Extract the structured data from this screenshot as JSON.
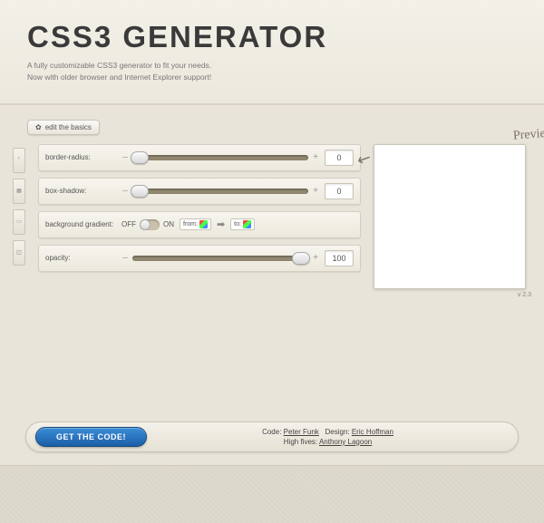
{
  "header": {
    "title": "CSS3 GENERATOR",
    "subtitle_line1": "A fully customizable CSS3 generator to fit your needs.",
    "subtitle_line2": "Now with older browser and Internet Explorer support!"
  },
  "edit_basics_label": "edit the basics",
  "controls": {
    "border_radius": {
      "label": "border-radius:",
      "value": "0"
    },
    "box_shadow": {
      "label": "box-shadow:",
      "value": "0"
    },
    "gradient": {
      "label": "background gradient:",
      "off": "OFF",
      "on": "ON",
      "from": "from:",
      "to": "to:"
    },
    "opacity": {
      "label": "opacity:",
      "value": "100"
    }
  },
  "preview": {
    "label": "Preview",
    "version": "v 2.3"
  },
  "footer": {
    "button": "GET THE CODE!",
    "code_label": "Code:",
    "code_name": "Peter Funk",
    "design_label": "Design:",
    "design_name": "Eric Hoffman",
    "highfive_label": "High fives:",
    "highfive_name": "Anthony Lagoon"
  }
}
